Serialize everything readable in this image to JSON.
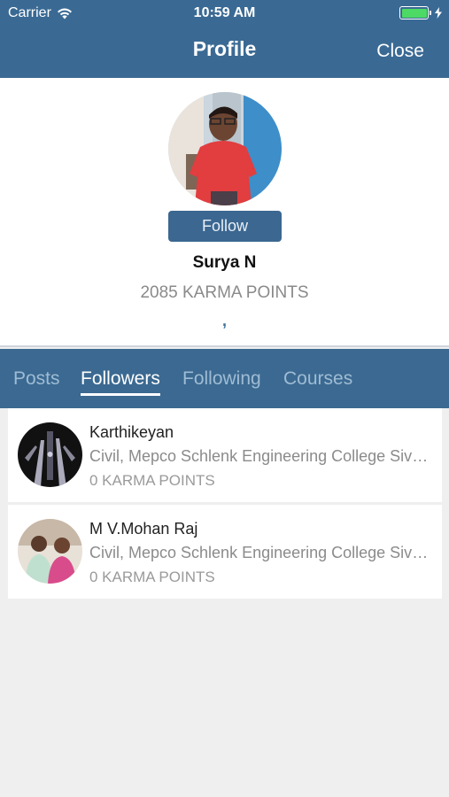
{
  "status_bar": {
    "carrier": "Carrier",
    "time": "10:59 AM"
  },
  "nav": {
    "title": "Profile",
    "close_label": "Close"
  },
  "profile": {
    "follow_label": "Follow",
    "name": "Surya N",
    "karma": "2085 KARMA POINTS",
    "bio": ","
  },
  "tabs": [
    {
      "label": "Posts",
      "active": false
    },
    {
      "label": "Followers",
      "active": true
    },
    {
      "label": "Following",
      "active": false
    },
    {
      "label": "Courses",
      "active": false
    }
  ],
  "followers": [
    {
      "name": "Karthikeyan",
      "dept": "Civil, Mepco Schlenk Engineering College Sivakasi",
      "points": "0 KARMA POINTS"
    },
    {
      "name": "M V.Mohan Raj",
      "dept": "Civil, Mepco Schlenk Engineering College Sivakasi",
      "points": "0 KARMA POINTS"
    }
  ],
  "colors": {
    "nav": "#3a6a94",
    "tab_bar": "#3b6991",
    "follow_button": "#3b6791",
    "battery": "#4cd964"
  }
}
